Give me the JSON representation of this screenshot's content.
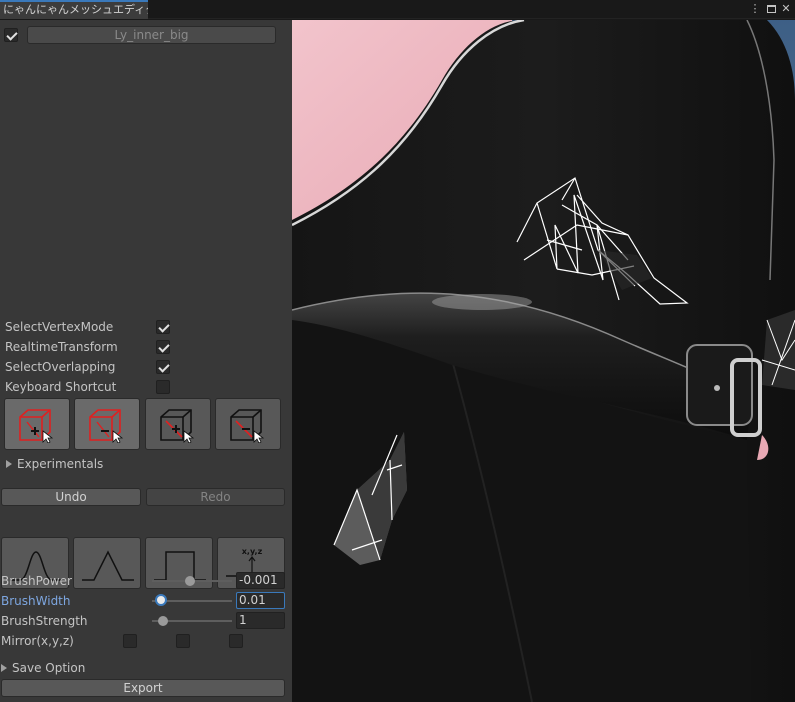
{
  "window": {
    "tab_title": "にゃんにゃんメッシュエディター",
    "more_icon": "⋮",
    "close_icon": "✕"
  },
  "mesh": {
    "enabled": true,
    "name": "Ly_inner_big"
  },
  "options": [
    {
      "label": "SelectVertexMode",
      "checked": true
    },
    {
      "label": "RealtimeTransform",
      "checked": true
    },
    {
      "label": "SelectOverlapping",
      "checked": true
    },
    {
      "label": "Keyboard Shortcut",
      "checked": false
    }
  ],
  "mode_buttons": [
    {
      "icon": "cube-select-add-icon",
      "active": true
    },
    {
      "icon": "cube-select-subtract-icon",
      "active": true
    },
    {
      "icon": "cube-box-add-icon",
      "active": false
    },
    {
      "icon": "cube-box-subtract-icon",
      "active": false
    }
  ],
  "experimentals_label": "Experimentals",
  "history": {
    "undo_label": "Undo",
    "redo_label": "Redo"
  },
  "brush_shapes": [
    {
      "icon": "smooth-curve-icon"
    },
    {
      "icon": "linear-peak-icon"
    },
    {
      "icon": "constant-step-icon"
    },
    {
      "icon": "xyz-axis-icon",
      "text": "x,y,z"
    }
  ],
  "brush": {
    "power": {
      "label": "BrushPower",
      "value": "-0.001",
      "fraction": 0.48
    },
    "width": {
      "label": "BrushWidth",
      "value": "0.01",
      "fraction": 0.14
    },
    "strength": {
      "label": "BrushStrength",
      "value": "1",
      "fraction": 0.14
    }
  },
  "mirror": {
    "label": "Mirror(x,y,z)",
    "x": false,
    "y": false,
    "z": false
  },
  "save_option_label": "Save Option",
  "export_label": "Export",
  "colors": {
    "accent": "#3a79bb",
    "panel_bg": "#383838",
    "red_icon": "#e02020"
  }
}
